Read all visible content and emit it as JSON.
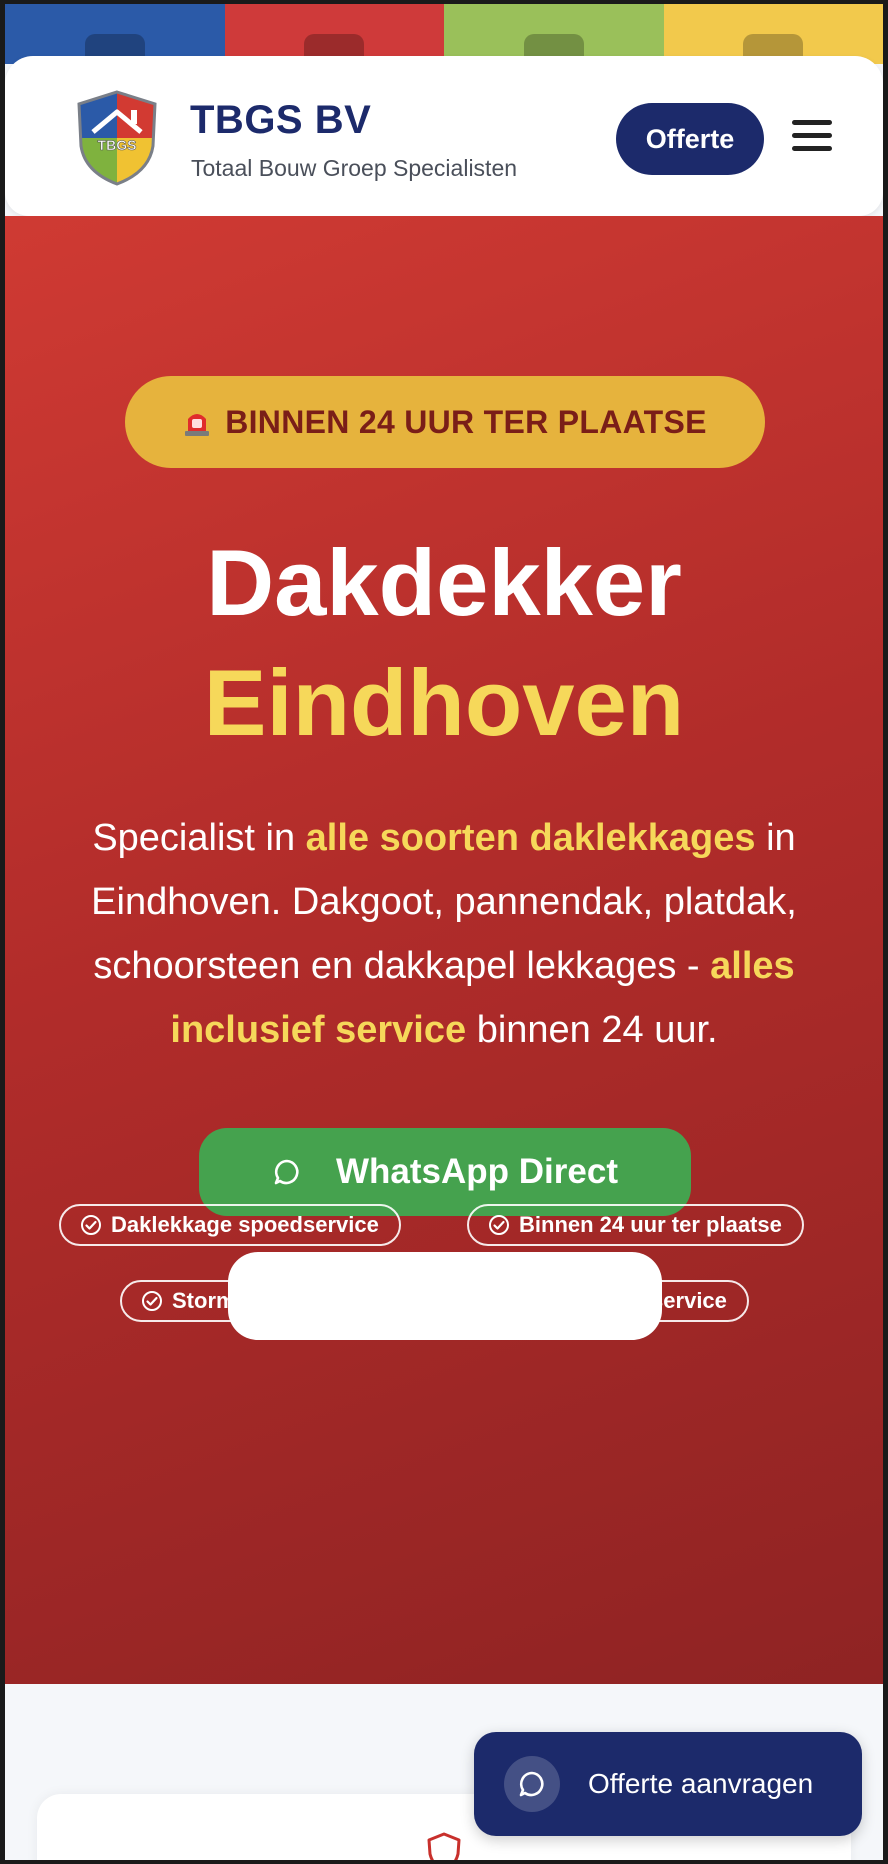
{
  "header": {
    "brand_title": "TBGS BV",
    "brand_subtitle": "Totaal Bouw Groep Specialisten",
    "logo_text": "TBGS",
    "offerte_label": "Offerte",
    "menu_icon": "hamburger-icon"
  },
  "hero": {
    "badge": "BINNEN 24 UUR TER PLAATSE",
    "title_line1": "Dakdekker",
    "title_line2": "Eindhoven",
    "desc_part1": "Specialist in ",
    "desc_highlight1": "alle soorten daklekkages",
    "desc_part2": " in Eindhoven. Dakgoot, pannendak, platdak, schoorsteen en dakkapel lekkages - ",
    "desc_highlight2": "alles inclusief service",
    "desc_part3": " binnen 24 uur.",
    "whatsapp_label": "WhatsApp Direct",
    "features": [
      "Daklekkage spoedservice",
      "Binnen 24 uur ter plaatse",
      "Stormdade herstel",
      "Alles inclusief service"
    ]
  },
  "floating": {
    "label": "Offerte aanvragen"
  },
  "colors": {
    "navy": "#1c2a6b",
    "hero_red": "#b12c2a",
    "accent_yellow": "#f6d85a",
    "badge_gold": "#e6b33d",
    "whatsapp_green": "#45a24e"
  }
}
